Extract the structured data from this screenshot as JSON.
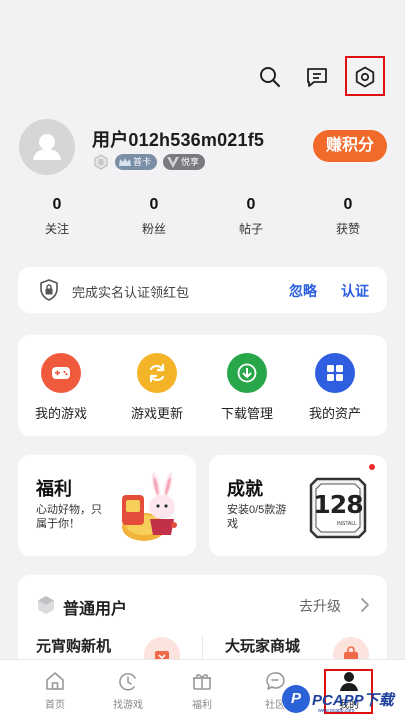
{
  "header": {
    "icons": [
      "search-icon",
      "message-icon",
      "settings-icon"
    ]
  },
  "profile": {
    "username": "用户012h536m021f5",
    "badges": [
      {
        "label": "普卡",
        "color": "#6b7f95"
      },
      {
        "label": "悦享",
        "color": "#7a7a7f"
      }
    ],
    "earn_button": "赚积分",
    "accent": "#f26a2a"
  },
  "stats": [
    {
      "value": "0",
      "label": "关注"
    },
    {
      "value": "0",
      "label": "粉丝"
    },
    {
      "value": "0",
      "label": "帖子"
    },
    {
      "value": "0",
      "label": "获赞"
    }
  ],
  "verify": {
    "text": "完成实名认证领红包",
    "ignore": "忽略",
    "verify": "认证",
    "link_color": "#2a5fe0"
  },
  "tools": [
    {
      "label": "我的游戏",
      "icon": "gamepad-icon",
      "color": "#f05a3c"
    },
    {
      "label": "游戏更新",
      "icon": "refresh-icon",
      "color": "#f3b428"
    },
    {
      "label": "下载管理",
      "icon": "download-icon",
      "color": "#27a64a"
    },
    {
      "label": "我的资产",
      "icon": "grid-icon",
      "color": "#2f5fe0"
    }
  ],
  "welfare": {
    "title": "福利",
    "subtitle": "心动好物，只属于你！"
  },
  "achievement": {
    "title": "成就",
    "subtitle": "安装0/5款游戏",
    "image_label": "128",
    "image_sub": "INSTALL"
  },
  "member": {
    "title": "普通用户",
    "upgrade": "去升级",
    "items": [
      "元宵购新机",
      "大玩家商城"
    ]
  },
  "tabbar": {
    "tabs": [
      "首页",
      "找游戏",
      "福利",
      "社区",
      "我的"
    ]
  },
  "watermark": {
    "logo": "P",
    "text": "PCAPP下载",
    "sub": "www.pcapp.com"
  }
}
